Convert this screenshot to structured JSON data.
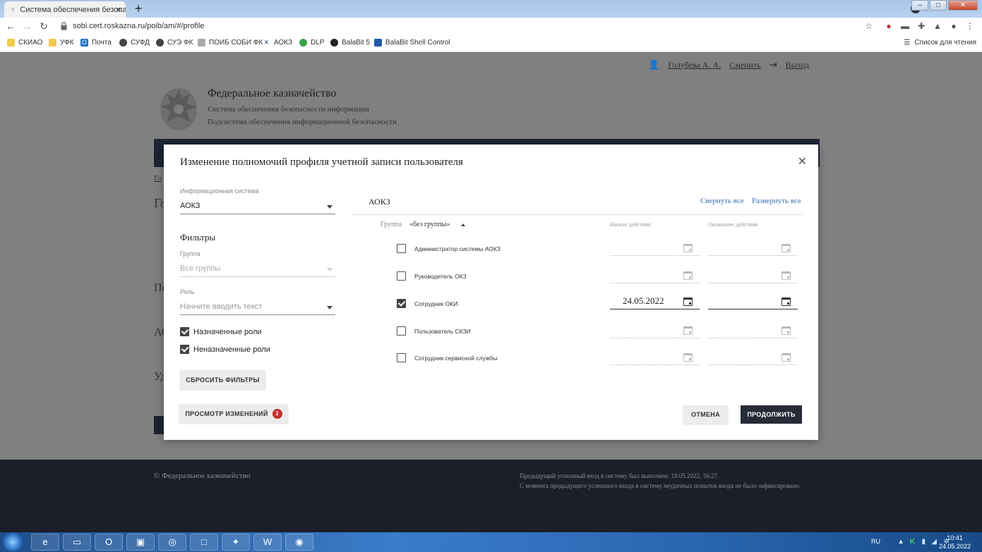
{
  "browser": {
    "tab_title": "Система обеспечения безопасн",
    "url": "sobi.cert.roskazna.ru/poib/am/#/profile",
    "bookmarks": [
      "СКИАО",
      "УФК",
      "Почта",
      "СУФД",
      "СУЭ ФК",
      "ПОИБ СОБИ ФК",
      "АОКЗ",
      "DLP",
      "BalaBit 5",
      "BalaBit Shell Control"
    ],
    "reading_list": "Список для чтения"
  },
  "page": {
    "user_name": "Голубева А. А.",
    "switch_label": "Сменить",
    "logout_label": "Выход",
    "org_title": "Федеральное казначейство",
    "org_sub1": "Система обеспечения безопасности информации",
    "org_sub2": "Подсистема обеспечения информационной безопасности",
    "bg_frag_1": "Гл",
    "bg_frag_2": "Го",
    "bg_frag_3": "По",
    "bg_frag_4": "АС",
    "bg_frag_5": "Уд"
  },
  "footer": {
    "copyright": "© Федеральное казначейство",
    "last_login": "Предыдущий успешный вход в систему был выполнен: 18.05.2022, 16:27.",
    "failed_attempts": "С момента предыдущего успешного входа в систему неудачных попыток входа не было зафиксировано."
  },
  "modal": {
    "title": "Изменение полномочий профиля учетной записи пользователя",
    "info_system_label": "Информационная система",
    "info_system_value": "АОКЗ",
    "filters_title": "Фильтры",
    "group_label": "Группа",
    "group_value": "Все группы",
    "role_label": "Роль",
    "role_placeholder": "Начните вводить текст",
    "assigned_roles": "Назначенные роли",
    "unassigned_roles": "Неназначенные роли",
    "reset_filters": "СБРОСИТЬ ФИЛЬТРЫ",
    "view_changes": "ПРОСМОТР ИЗМЕНЕНИЙ",
    "changes_count": "1",
    "cancel": "ОТМЕНА",
    "continue": "ПРОДОЛЖИТЬ",
    "system_title": "АОКЗ",
    "collapse_all": "Свернуть все",
    "expand_all": "Развернуть все",
    "group_row_label": "Группа",
    "group_row_value": "«без группы»",
    "col_start": "Начало действия",
    "col_end": "Окончание действия",
    "roles": [
      {
        "name": "Администратор системы АОКЗ",
        "checked": false,
        "start": "",
        "end": ""
      },
      {
        "name": "Руководитель ОКЗ",
        "checked": false,
        "start": "",
        "end": ""
      },
      {
        "name": "Сотрудник ОКИ",
        "checked": true,
        "start": "24.05.2022",
        "end": ""
      },
      {
        "name": "Пользователь СКЗИ",
        "checked": false,
        "start": "",
        "end": ""
      },
      {
        "name": "Сотрудник сервисной службы",
        "checked": false,
        "start": "",
        "end": ""
      }
    ]
  },
  "taskbar": {
    "lang": "RU",
    "time": "10:41",
    "date": "24.05.2022"
  }
}
